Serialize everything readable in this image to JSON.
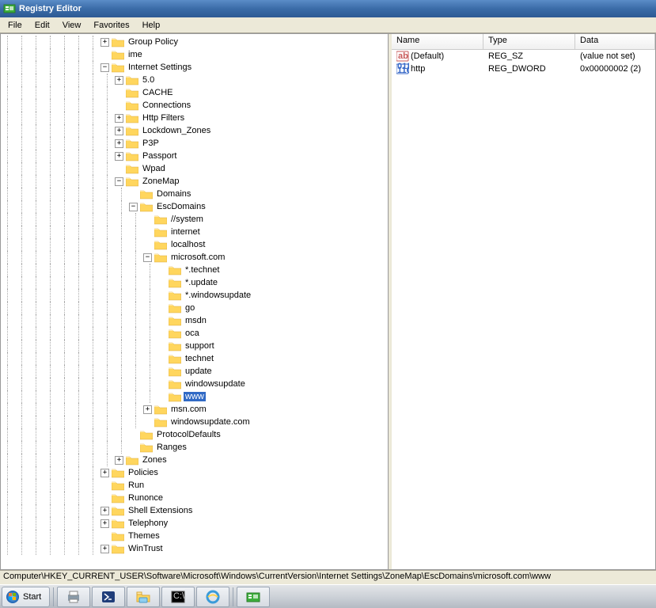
{
  "window": {
    "title": "Registry Editor"
  },
  "menu": {
    "items": [
      "File",
      "Edit",
      "View",
      "Favorites",
      "Help"
    ]
  },
  "list": {
    "columns": [
      "Name",
      "Type",
      "Data"
    ],
    "rows": [
      {
        "icon": "string",
        "name": "(Default)",
        "type": "REG_SZ",
        "data": "(value not set)"
      },
      {
        "icon": "dword",
        "name": "http",
        "type": "REG_DWORD",
        "data": "0x00000002 (2)"
      }
    ]
  },
  "tree": {
    "nodes": [
      {
        "depth": 7,
        "toggle": "plus",
        "label": "Group Policy"
      },
      {
        "depth": 7,
        "toggle": null,
        "label": "ime"
      },
      {
        "depth": 7,
        "toggle": "minus",
        "label": "Internet Settings"
      },
      {
        "depth": 8,
        "toggle": "plus",
        "label": "5.0"
      },
      {
        "depth": 8,
        "toggle": null,
        "label": "CACHE"
      },
      {
        "depth": 8,
        "toggle": null,
        "label": "Connections"
      },
      {
        "depth": 8,
        "toggle": "plus",
        "label": "Http Filters"
      },
      {
        "depth": 8,
        "toggle": "plus",
        "label": "Lockdown_Zones"
      },
      {
        "depth": 8,
        "toggle": "plus",
        "label": "P3P"
      },
      {
        "depth": 8,
        "toggle": "plus",
        "label": "Passport"
      },
      {
        "depth": 8,
        "toggle": null,
        "label": "Wpad"
      },
      {
        "depth": 8,
        "toggle": "minus",
        "label": "ZoneMap"
      },
      {
        "depth": 9,
        "toggle": null,
        "label": "Domains"
      },
      {
        "depth": 9,
        "toggle": "minus",
        "label": "EscDomains"
      },
      {
        "depth": 10,
        "toggle": null,
        "label": "//system"
      },
      {
        "depth": 10,
        "toggle": null,
        "label": "internet"
      },
      {
        "depth": 10,
        "toggle": null,
        "label": "localhost"
      },
      {
        "depth": 10,
        "toggle": "minus",
        "label": "microsoft.com"
      },
      {
        "depth": 11,
        "toggle": null,
        "label": "*.technet"
      },
      {
        "depth": 11,
        "toggle": null,
        "label": "*.update"
      },
      {
        "depth": 11,
        "toggle": null,
        "label": "*.windowsupdate"
      },
      {
        "depth": 11,
        "toggle": null,
        "label": "go"
      },
      {
        "depth": 11,
        "toggle": null,
        "label": "msdn"
      },
      {
        "depth": 11,
        "toggle": null,
        "label": "oca"
      },
      {
        "depth": 11,
        "toggle": null,
        "label": "support"
      },
      {
        "depth": 11,
        "toggle": null,
        "label": "technet"
      },
      {
        "depth": 11,
        "toggle": null,
        "label": "update"
      },
      {
        "depth": 11,
        "toggle": null,
        "label": "windowsupdate"
      },
      {
        "depth": 11,
        "toggle": null,
        "label": "www",
        "selected": true
      },
      {
        "depth": 10,
        "toggle": "plus",
        "label": "msn.com"
      },
      {
        "depth": 10,
        "toggle": null,
        "label": "windowsupdate.com"
      },
      {
        "depth": 9,
        "toggle": null,
        "label": "ProtocolDefaults"
      },
      {
        "depth": 9,
        "toggle": null,
        "label": "Ranges"
      },
      {
        "depth": 8,
        "toggle": "plus",
        "label": "Zones"
      },
      {
        "depth": 7,
        "toggle": "plus",
        "label": "Policies"
      },
      {
        "depth": 7,
        "toggle": null,
        "label": "Run"
      },
      {
        "depth": 7,
        "toggle": null,
        "label": "Runonce"
      },
      {
        "depth": 7,
        "toggle": "plus",
        "label": "Shell Extensions"
      },
      {
        "depth": 7,
        "toggle": "plus",
        "label": "Telephony"
      },
      {
        "depth": 7,
        "toggle": null,
        "label": "Themes"
      },
      {
        "depth": 7,
        "toggle": "plus",
        "label": "WinTrust"
      }
    ]
  },
  "status": {
    "path": "Computer\\HKEY_CURRENT_USER\\Software\\Microsoft\\Windows\\CurrentVersion\\Internet Settings\\ZoneMap\\EscDomains\\microsoft.com\\www"
  },
  "taskbar": {
    "start": "Start",
    "items": [
      "printer",
      "powershell",
      "explorer",
      "cmd",
      "ie",
      "regedit"
    ]
  }
}
